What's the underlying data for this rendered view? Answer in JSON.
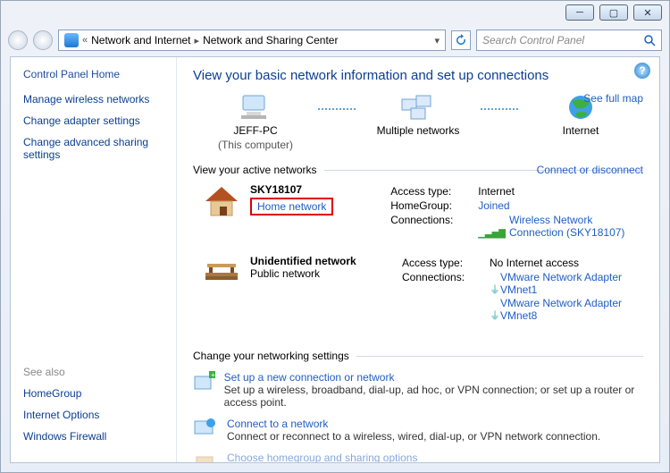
{
  "breadcrumb": {
    "root": "Network and Internet",
    "current": "Network and Sharing Center",
    "back_tip": "«"
  },
  "search": {
    "placeholder": "Search Control Panel"
  },
  "left": {
    "home": "Control Panel Home",
    "links": [
      "Manage wireless networks",
      "Change adapter settings",
      "Change advanced sharing settings"
    ],
    "see_also_hdr": "See also",
    "see_also": [
      "HomeGroup",
      "Internet Options",
      "Windows Firewall"
    ]
  },
  "page": {
    "title": "View your basic network information and set up connections",
    "see_full_map": "See full map",
    "map": {
      "pc_name": "JEFF-PC",
      "pc_sub": "(This computer)",
      "mid": "Multiple networks",
      "internet": "Internet"
    },
    "active_hdr": "View your active networks",
    "connect_or_disconnect": "Connect or disconnect",
    "networks": [
      {
        "name": "SKY18107",
        "type_label": "Home network",
        "highlight": true,
        "attrs": {
          "access": {
            "k": "Access type:",
            "v": "Internet",
            "link": false
          },
          "homegroup": {
            "k": "HomeGroup:",
            "v": "Joined",
            "link": true
          },
          "connections": {
            "k": "Connections:",
            "v": "Wireless Network Connection (SKY18107)",
            "link": true,
            "signal": true
          }
        }
      },
      {
        "name": "Unidentified network",
        "type_label": "Public network",
        "highlight": false,
        "attrs": {
          "access": {
            "k": "Access type:",
            "v": "No Internet access",
            "link": false
          },
          "connections": {
            "k": "Connections:",
            "v": [
              "VMware Network Adapter VMnet1",
              "VMware Network Adapter VMnet8"
            ],
            "link": true
          }
        }
      }
    ],
    "change_hdr": "Change your networking settings",
    "settings": [
      {
        "h": "Set up a new connection or network",
        "d": "Set up a wireless, broadband, dial-up, ad hoc, or VPN connection; or set up a router or access point."
      },
      {
        "h": "Connect to a network",
        "d": "Connect or reconnect to a wireless, wired, dial-up, or VPN network connection."
      },
      {
        "h": "Choose homegroup and sharing options",
        "d": ""
      }
    ]
  }
}
